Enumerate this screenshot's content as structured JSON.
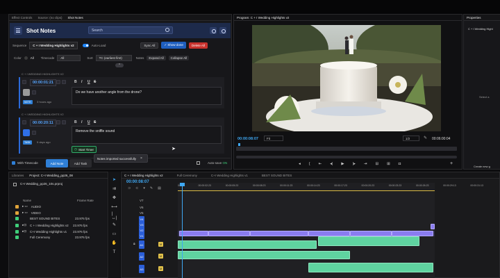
{
  "top_tabs": [
    "Effect Controls",
    "Source: (no clips)",
    "Shot Notes"
  ],
  "program_tab": "Program: C + I Wedding Highlights v2",
  "properties_tab": "Properties",
  "properties_item": "C + I Wedding Highl",
  "properties_hint": "Select a",
  "shot_notes": {
    "title": "Shot Notes",
    "search_placeholder": "Search",
    "sequence_label": "Sequence",
    "sequence_value": "C + I Wedding Highlights v2",
    "auto_load": "Auto-Load",
    "sync_all": "Sync All",
    "show_done": "✓ Show done",
    "delete_all": "Delete All",
    "color_label": "Color",
    "color_value": "All",
    "timecode_label": "Timecode",
    "timecode_value": "All",
    "sort_label": "Sort",
    "sort_value": "TC (earliest first)",
    "notes_label": "Notes",
    "expand_all": "Expand All",
    "collapse_all": "Collapse All",
    "notes": [
      {
        "header": "C + I WEDDING HIGHLIGHTS V2",
        "timecode": "00:00:01:21",
        "text": "Do we have another angle from the drone?",
        "tag": "NOTE",
        "tag_color": "#2f7fd6",
        "swatch_color": "#9a9a9a",
        "age": "3 hours ago"
      },
      {
        "header": "C + I WEDDING HIGHLIGHTS V2",
        "timecode": "00:00:20:11",
        "text": "Remove the sniffle sound",
        "tag": "TASK",
        "tag_color": "#2f7fd6",
        "swatch_color": "#2f6fe8",
        "age": "5 days ago",
        "timer": "Start Timer"
      }
    ],
    "with_timecode": "With Timecode",
    "add_note": "Add Note",
    "add_task": "Add Task",
    "toast": "Notes imported successfully",
    "toast_close": "×",
    "auto_save": "Auto-save",
    "auto_save_state": "ON"
  },
  "monitor": {
    "timecode_in": "00:00:08:07",
    "fit": "Fit",
    "quality": "1/2",
    "duration": "00:06:00:04"
  },
  "project": {
    "tab_bins": "Libraries",
    "tab_project": "Project: C+I Wedding_pp26_08",
    "project_file": "C+I Wedding_pp26_10s.prproj",
    "col_name": "Name",
    "col_rate": "Frame Rate",
    "items": [
      {
        "name": "AUDIO",
        "rate": "",
        "color": "#e0a43a"
      },
      {
        "name": "VIDEO",
        "rate": "",
        "color": "#e0a43a"
      },
      {
        "name": "BEST SOUND BITES",
        "rate": "23.976 fps",
        "color": "#3fcf7a"
      },
      {
        "name": "C + I Wedding Highlights v2",
        "rate": "23.976 fps",
        "color": "#3fcf7a"
      },
      {
        "name": "C+I Wedding Highlights v1",
        "rate": "23.976 fps",
        "color": "#3fcf7a"
      },
      {
        "name": "Full Ceremony",
        "rate": "23.976 fps",
        "color": "#3fcf7a"
      }
    ]
  },
  "timeline": {
    "tabs": [
      "C + I Wedding Highlights v2",
      "Full Ceremony",
      "C+I Wedding Highlights v1",
      "BEST SOUND BITES"
    ],
    "timecode": "00:00:08:07",
    "ruler": [
      "00:00",
      "00:00:02:23",
      "00:00:05:23",
      "00:00:08:23",
      "00:00:11:23",
      "00:00:14:23",
      "00:00:17:23",
      "00:00:20:23",
      "00:00:23:23",
      "00:00:26:23",
      "00:00:29:13",
      "00:00:31:13"
    ],
    "video_tracks": [
      "V7",
      "V6",
      "V5",
      "V4",
      "V3",
      "V2",
      "V1"
    ],
    "audio_tracks": [
      "A1",
      "A2",
      "A3"
    ],
    "create_new": "Create new g"
  }
}
